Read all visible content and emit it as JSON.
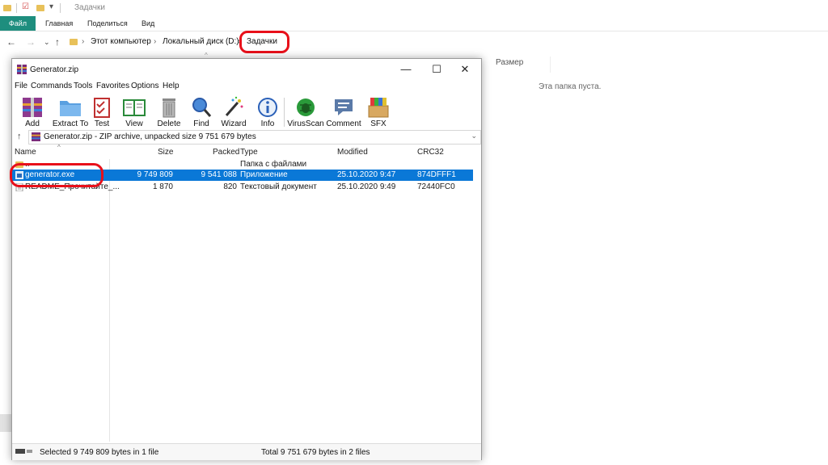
{
  "explorer": {
    "title": "Задачки",
    "ribbon_tabs": [
      "Файл",
      "Главная",
      "Поделиться",
      "Вид"
    ],
    "breadcrumbs": [
      "Этот компьютер",
      "Локальный диск (D:)",
      "Задачки"
    ],
    "columns": {
      "size": "Размер"
    },
    "empty_message": "Эта папка пуста."
  },
  "winrar": {
    "title": "Generator.zip",
    "menu": [
      "File",
      "Commands",
      "Tools",
      "Favorites",
      "Options",
      "Help"
    ],
    "toolbar": [
      "Add",
      "Extract To",
      "Test",
      "View",
      "Delete",
      "Find",
      "Wizard",
      "Info",
      "VirusScan",
      "Comment",
      "SFX"
    ],
    "path": "Generator.zip - ZIP archive, unpacked size 9 751 679 bytes",
    "columns": {
      "name": "Name",
      "size": "Size",
      "packed": "Packed",
      "type": "Type",
      "modified": "Modified",
      "crc": "CRC32"
    },
    "rows": [
      {
        "name": "..",
        "size": "",
        "packed": "",
        "type": "Папка с файлами",
        "modified": "",
        "crc": ""
      },
      {
        "name": "generator.exe",
        "size": "9 749 809",
        "packed": "9 541 088",
        "type": "Приложение",
        "modified": "25.10.2020 9:47",
        "crc": "874DFFF1"
      },
      {
        "name": "README_Прочитайте_...",
        "size": "1 870",
        "packed": "820",
        "type": "Текстовый документ",
        "modified": "25.10.2020 9:49",
        "crc": "72440FC0"
      }
    ],
    "status_left": "Selected 9 749 809 bytes in 1 file",
    "status_right": "Total 9 751 679 bytes in 2 files",
    "selected_row_color": "#0a78d7",
    "window_buttons": [
      "—",
      "☐",
      "✕"
    ]
  },
  "colors": {
    "highlight": "#e8101a",
    "ribbon_file_tab": "#1e8e7e"
  }
}
